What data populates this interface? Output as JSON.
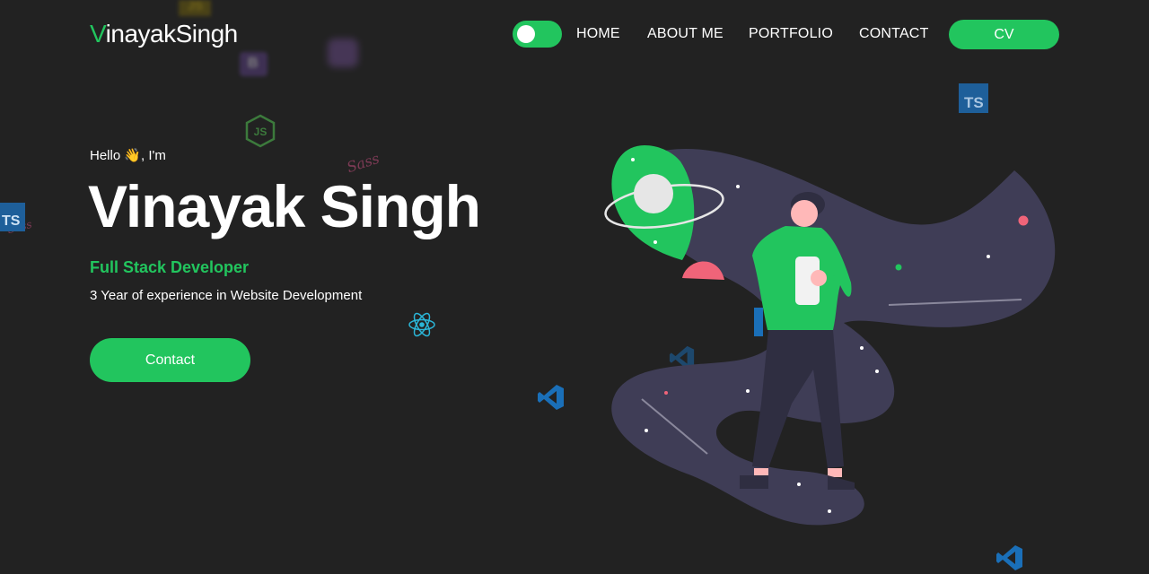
{
  "nav": {
    "logo_first": "V",
    "logo_rest": "inayakSingh",
    "links": [
      "HOME",
      "ABOUT ME",
      "PORTFOLIO",
      "CONTACT"
    ],
    "cv_label": "CV"
  },
  "hero": {
    "greeting": "Hello 👋, I'm",
    "name": "Vinayak Singh",
    "role": "Full Stack Developer",
    "description": "3 Year of experience in Website Development",
    "contact_label": "Contact"
  },
  "floating_icons": {
    "js_label": "JS",
    "bootstrap_label": "B",
    "node_label": "JS",
    "sass_label": "Sass",
    "ts_label": "TS"
  },
  "theme": {
    "accent": "#22c55e",
    "background": "#222222",
    "blob": "#3f3d56",
    "pink": "#f06479"
  }
}
